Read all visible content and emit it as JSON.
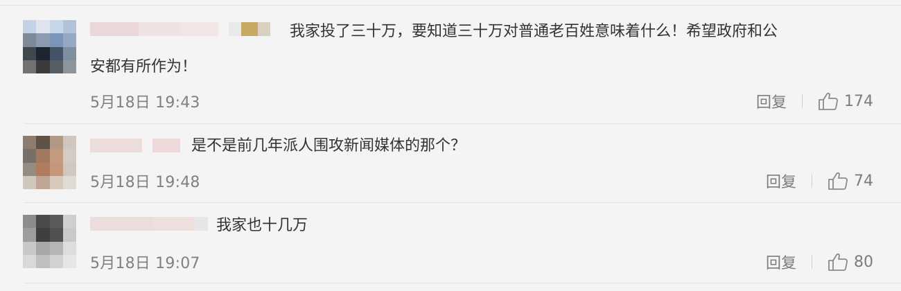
{
  "comments": [
    {
      "text_line1": "我家投了三十万，要知道三十万对普通老百姓意味着什么！希望政府和公",
      "text_line2": "安都有所作为！",
      "time": "5月18日 19:43",
      "reply_label": "回复",
      "likes": "174"
    },
    {
      "text_line1": "是不是前几年派人围攻新闻媒体的那个？",
      "time": "5月18日 19:48",
      "reply_label": "回复",
      "likes": "74"
    },
    {
      "text_line1": "我家也十几万",
      "time": "5月18日 19:07",
      "reply_label": "回复",
      "likes": "80"
    }
  ],
  "icons": {
    "like": "thumbs-up-icon",
    "avatar": "pixelated-avatar",
    "username": "blurred-username"
  },
  "colors": {
    "background": "#f4f4f4",
    "text": "#333333",
    "meta": "#808080",
    "divider": "#e3e3e3"
  }
}
